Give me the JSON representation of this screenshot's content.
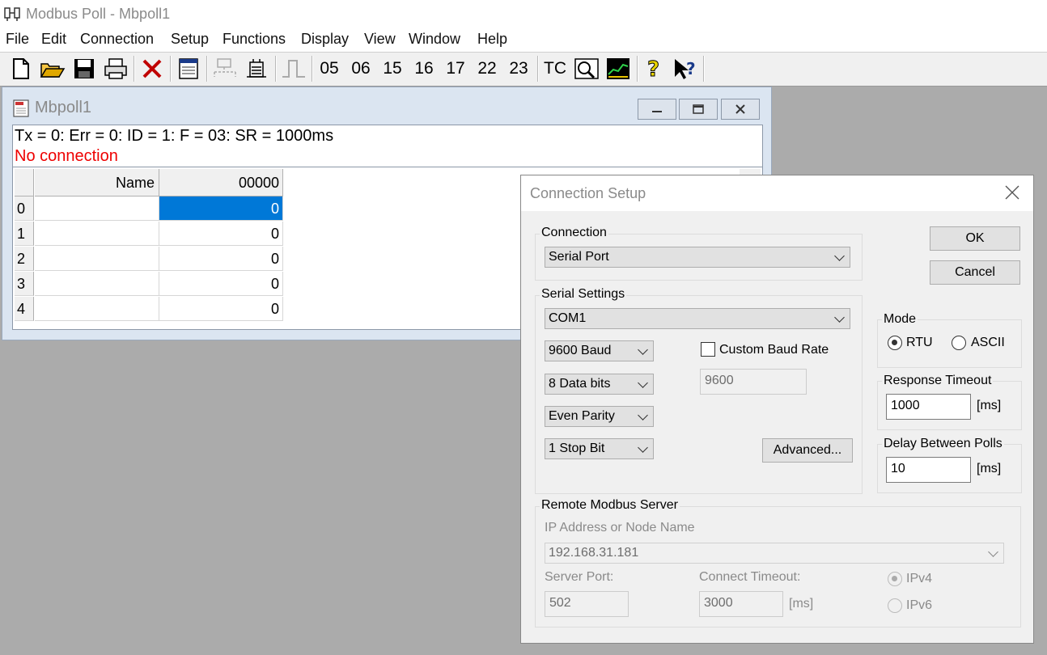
{
  "app": {
    "title": "Modbus Poll - Mbpoll1"
  },
  "menu": [
    "File",
    "Edit",
    "Connection",
    "Setup",
    "Functions",
    "Display",
    "View",
    "Window",
    "Help"
  ],
  "toolbar": {
    "function_codes": [
      "05",
      "06",
      "15",
      "16",
      "17",
      "22",
      "23"
    ],
    "tc_label": "TC",
    "icons": [
      "new-icon",
      "open-icon",
      "save-icon",
      "print-icon",
      "delete-icon",
      "window-icon",
      "connect-icon",
      "disconnect-icon",
      "pulse-icon",
      "tc-icon",
      "comm-traffic-icon",
      "chart-icon",
      "help-icon",
      "context-help-icon"
    ]
  },
  "child": {
    "title": "Mbpoll1",
    "status": "Tx = 0: Err = 0: ID = 1: F = 03: SR = 1000ms",
    "connection_status": "No connection",
    "grid": {
      "headers": [
        "Name",
        "00000"
      ],
      "rows": [
        {
          "index": "0",
          "name": "",
          "value": "0"
        },
        {
          "index": "1",
          "name": "",
          "value": "0"
        },
        {
          "index": "2",
          "name": "",
          "value": "0"
        },
        {
          "index": "3",
          "name": "",
          "value": "0"
        },
        {
          "index": "4",
          "name": "",
          "value": "0"
        }
      ]
    }
  },
  "dialog": {
    "title": "Connection Setup",
    "connection_group": "Connection",
    "connection_value": "Serial Port",
    "serial_group": "Serial Settings",
    "port": "COM1",
    "baud": "9600 Baud",
    "data_bits": "8 Data bits",
    "parity": "Even Parity",
    "stop_bits": "1 Stop Bit",
    "custom_baud_label": "Custom Baud Rate",
    "custom_baud_value": "9600",
    "advanced_button": "Advanced...",
    "ok_button": "OK",
    "cancel_button": "Cancel",
    "mode_group": "Mode",
    "mode_rtu": "RTU",
    "mode_ascii": "ASCII",
    "response_timeout_group": "Response Timeout",
    "response_timeout_value": "1000",
    "response_timeout_unit": "[ms]",
    "delay_group": "Delay Between Polls",
    "delay_value": "10",
    "delay_unit": "[ms]",
    "remote_group": "Remote Modbus Server",
    "ip_label": "IP Address or Node Name",
    "ip_value": "192.168.31.181",
    "server_port_label": "Server Port:",
    "server_port_value": "502",
    "connect_timeout_label": "Connect Timeout:",
    "connect_timeout_value": "3000",
    "connect_timeout_unit": "[ms]",
    "ipv4": "IPv4",
    "ipv6": "IPv6"
  }
}
